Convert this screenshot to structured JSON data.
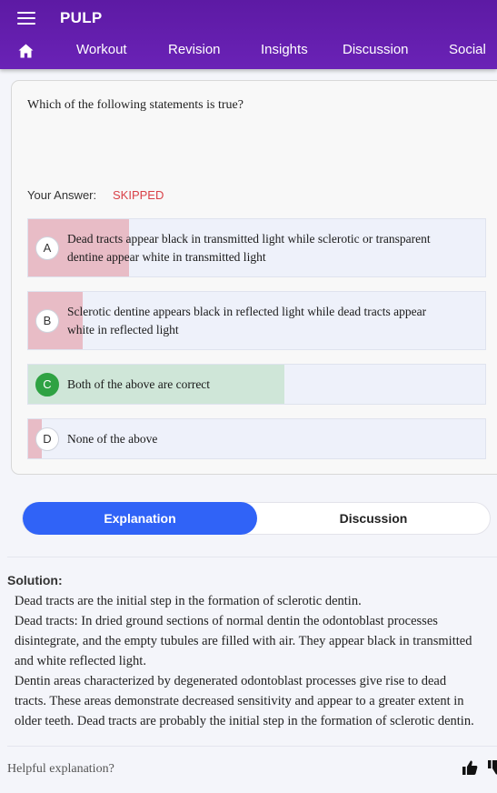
{
  "app": {
    "title": "PULP",
    "nav": [
      "Workout",
      "Revision",
      "Insights",
      "Discussion",
      "Social"
    ]
  },
  "question": {
    "text": "Which of the following statements is true?",
    "answer_label": "Your Answer:",
    "answer_value": "SKIPPED",
    "options": [
      {
        "letter": "A",
        "text": "Dead tracts appear black in transmitted light while sclerotic or transparent dentine appear white in transmitted light",
        "fill_fraction": 0.22,
        "status": "wrong"
      },
      {
        "letter": "B",
        "text": "Sclerotic dentine appears black in reflected light while dead tracts appear white in reflected light",
        "fill_fraction": 0.12,
        "status": "wrong"
      },
      {
        "letter": "C",
        "text": "Both of the above are correct",
        "fill_fraction": 0.56,
        "status": "correct"
      },
      {
        "letter": "D",
        "text": "None of the above",
        "fill_fraction": 0.03,
        "status": "wrong"
      }
    ]
  },
  "tabs": {
    "explanation": "Explanation",
    "discussion": "Discussion",
    "active": "explanation"
  },
  "solution": {
    "label": "Solution:",
    "lines": [
      "Dead tracts are the initial step in the formation of sclerotic dentin.",
      "Dead tracts: In dried ground sections of normal dentin the odontoblast processes",
      "disintegrate, and the empty tubules are filled with air. They appear black in transmitted",
      "and white reflected light.",
      "Dentin areas characterized by degenerated odontoblast processes give rise to dead",
      "tracts. These areas demonstrate decreased sensitivity and appear to a greater extent in",
      "older teeth. Dead tracts are probably the initial step in the formation of sclerotic dentin."
    ]
  },
  "feedback": {
    "prompt": "Helpful explanation?",
    "icons": [
      "thumbs-up-icon",
      "thumbs-down-icon"
    ]
  },
  "colors": {
    "header": "#5d1aa4",
    "accent": "#3063f7",
    "wrong_fill": "#e8bcc6",
    "correct_fill": "#cfe6d8",
    "correct_badge": "#2fa243",
    "skipped": "#d94148"
  }
}
